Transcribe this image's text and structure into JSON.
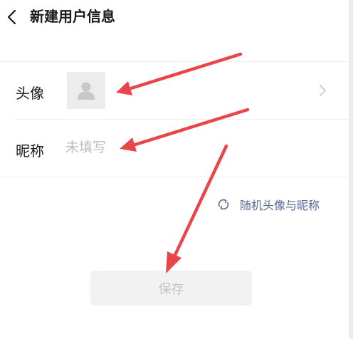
{
  "header": {
    "title": "新建用户信息"
  },
  "avatar_row": {
    "label": "头像"
  },
  "nickname_row": {
    "label": "昵称",
    "placeholder": "未填写",
    "value": ""
  },
  "random_link": {
    "label": "随机头像与昵称"
  },
  "save_button": {
    "label": "保存"
  },
  "colors": {
    "link": "#576b95",
    "annotation_arrow": "#e8464b",
    "disabled_button_bg": "#f2f2f2",
    "disabled_button_text": "#c4c4c4"
  },
  "icons": {
    "back": "chevron-left-icon",
    "avatar_placeholder": "person-icon",
    "row_arrow": "chevron-right-icon",
    "refresh": "refresh-icon"
  }
}
